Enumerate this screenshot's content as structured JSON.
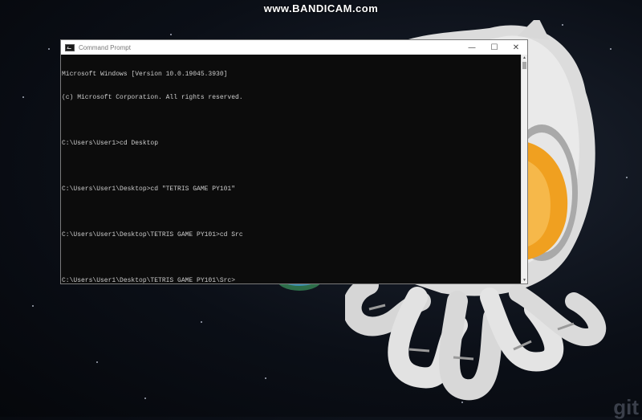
{
  "watermark": "www.BANDICAM.com",
  "window": {
    "title": "Command Prompt",
    "icon": "cmd-icon",
    "controls": {
      "minimize": "—",
      "maximize": "☐",
      "close": "✕"
    }
  },
  "console": {
    "lines": [
      "Microsoft Windows [Version 10.0.19045.3930]",
      "(c) Microsoft Corporation. All rights reserved.",
      "",
      "C:\\Users\\User1>cd Desktop",
      "",
      "C:\\Users\\User1\\Desktop>cd \"TETRIS GAME PY101\"",
      "",
      "C:\\Users\\User1\\Desktop\\TETRIS GAME PY101>cd Src",
      "",
      "C:\\Users\\User1\\Desktop\\TETRIS GAME PY101\\Src>"
    ]
  },
  "scrollbar": {
    "up": "▲",
    "down": "▼"
  },
  "wallpaper": {
    "corner_text": "git"
  }
}
